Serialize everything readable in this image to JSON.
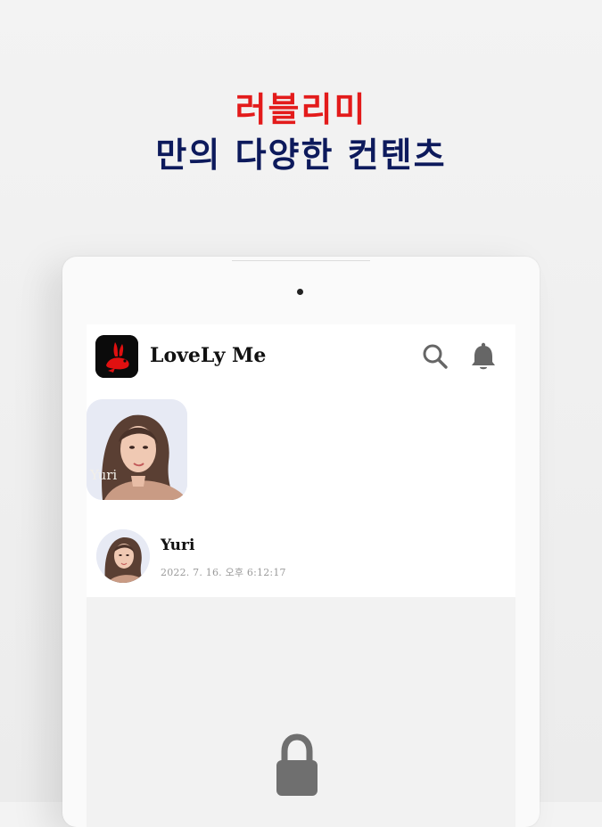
{
  "headline": {
    "line1": "러블리미",
    "line2": "만의 다양한 컨텐츠",
    "line1_color": "#e31b1b",
    "line2_color": "#0d1a5c"
  },
  "app": {
    "title": "LoveLy Me",
    "logo_icon": "rabbit-logo-icon",
    "actions": [
      {
        "icon": "search-icon"
      },
      {
        "icon": "bell-icon"
      }
    ]
  },
  "stories": [
    {
      "name": "Yuri"
    }
  ],
  "post": {
    "author": "Yuri",
    "timestamp": "2022. 7. 16. 오후 6:12:17",
    "content_state_icon": "lock-icon"
  }
}
